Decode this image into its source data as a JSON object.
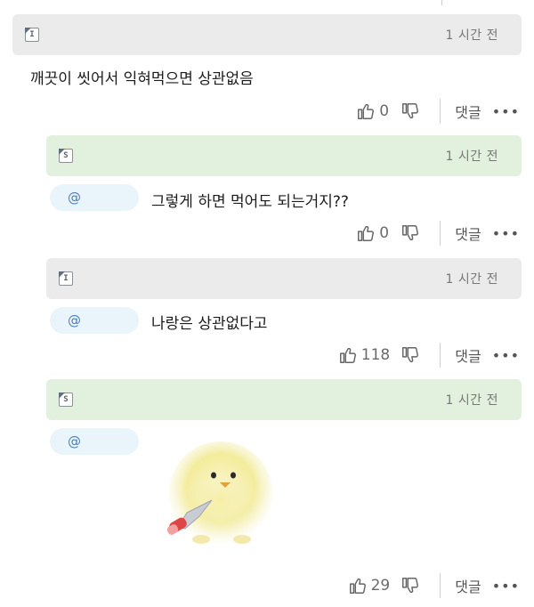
{
  "comments": [
    {
      "author_badge": "I",
      "time": "1 시간 전",
      "mention": "",
      "text": "깨끗이 씻어서 익혀먹으면 상관없음",
      "likes": "0",
      "reply_label": "댓글",
      "more_label": "•••",
      "header_color": "#ebebeb"
    },
    {
      "author_badge": "S",
      "time": "1 시간 전",
      "mention": "@",
      "text": "그렇게 하면 먹어도 되는거지??",
      "likes": "0",
      "reply_label": "댓글",
      "more_label": "•••",
      "header_color": "#e2f1dd"
    },
    {
      "author_badge": "I",
      "time": "1 시간 전",
      "mention": "@",
      "text": "나랑은 상관없다고",
      "likes": "118",
      "reply_label": "댓글",
      "more_label": "•••",
      "header_color": "#ebebeb"
    },
    {
      "author_badge": "S",
      "time": "1 시간 전",
      "mention": "@",
      "text": "",
      "image": "chick-with-knife",
      "likes": "29",
      "reply_label": "댓글",
      "more_label": "•••",
      "header_color": "#e2f1dd"
    }
  ],
  "icons": {
    "like": "thumbs-up-icon",
    "dislike": "thumbs-down-icon",
    "more": "more-dots-icon"
  }
}
